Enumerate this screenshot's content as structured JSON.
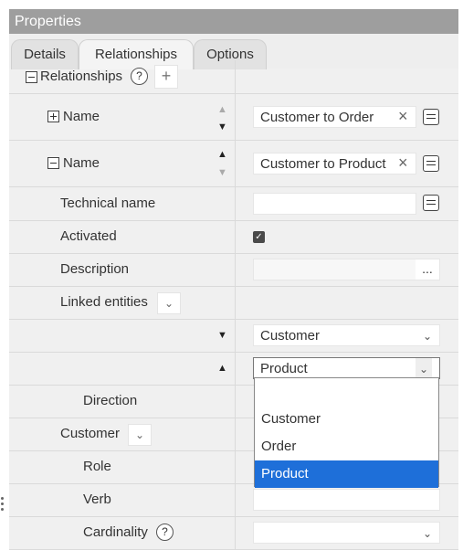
{
  "panel": {
    "title": "Properties"
  },
  "tabs": [
    {
      "label": "Details",
      "active": false
    },
    {
      "label": "Relationships",
      "active": true
    },
    {
      "label": "Options",
      "active": false
    }
  ],
  "relationships": {
    "section_label": "Relationships",
    "help_glyph": "?",
    "add_glyph": "+",
    "items": [
      {
        "label": "Name",
        "value": "Customer to Order",
        "expanded": false
      },
      {
        "label": "Name",
        "value": "Customer to Product",
        "expanded": true
      }
    ],
    "technical_name": {
      "label": "Technical name",
      "value": ""
    },
    "activated": {
      "label": "Activated",
      "checked": true
    },
    "description": {
      "label": "Description",
      "value": "",
      "button": "..."
    },
    "linked_entities": {
      "label": "Linked entities",
      "entity1": "Customer",
      "entity2": "Product"
    },
    "direction": {
      "label": "Direction"
    },
    "customer_group": {
      "label": "Customer",
      "role_label": "Role",
      "verb_label": "Verb",
      "cardinality_label": "Cardinality"
    }
  },
  "dropdown": {
    "options": [
      "",
      "Customer",
      "Order",
      "Product"
    ],
    "selected": "Product"
  },
  "colors": {
    "titlebar": "#9e9e9e",
    "selection": "#1e6fd9"
  },
  "icons": [
    "collapse-icon",
    "expand-icon",
    "help-icon",
    "add-icon",
    "clear-icon",
    "menu-icon",
    "chevron-down-icon",
    "triangle-up-icon",
    "triangle-down-icon",
    "checkbox-icon"
  ]
}
